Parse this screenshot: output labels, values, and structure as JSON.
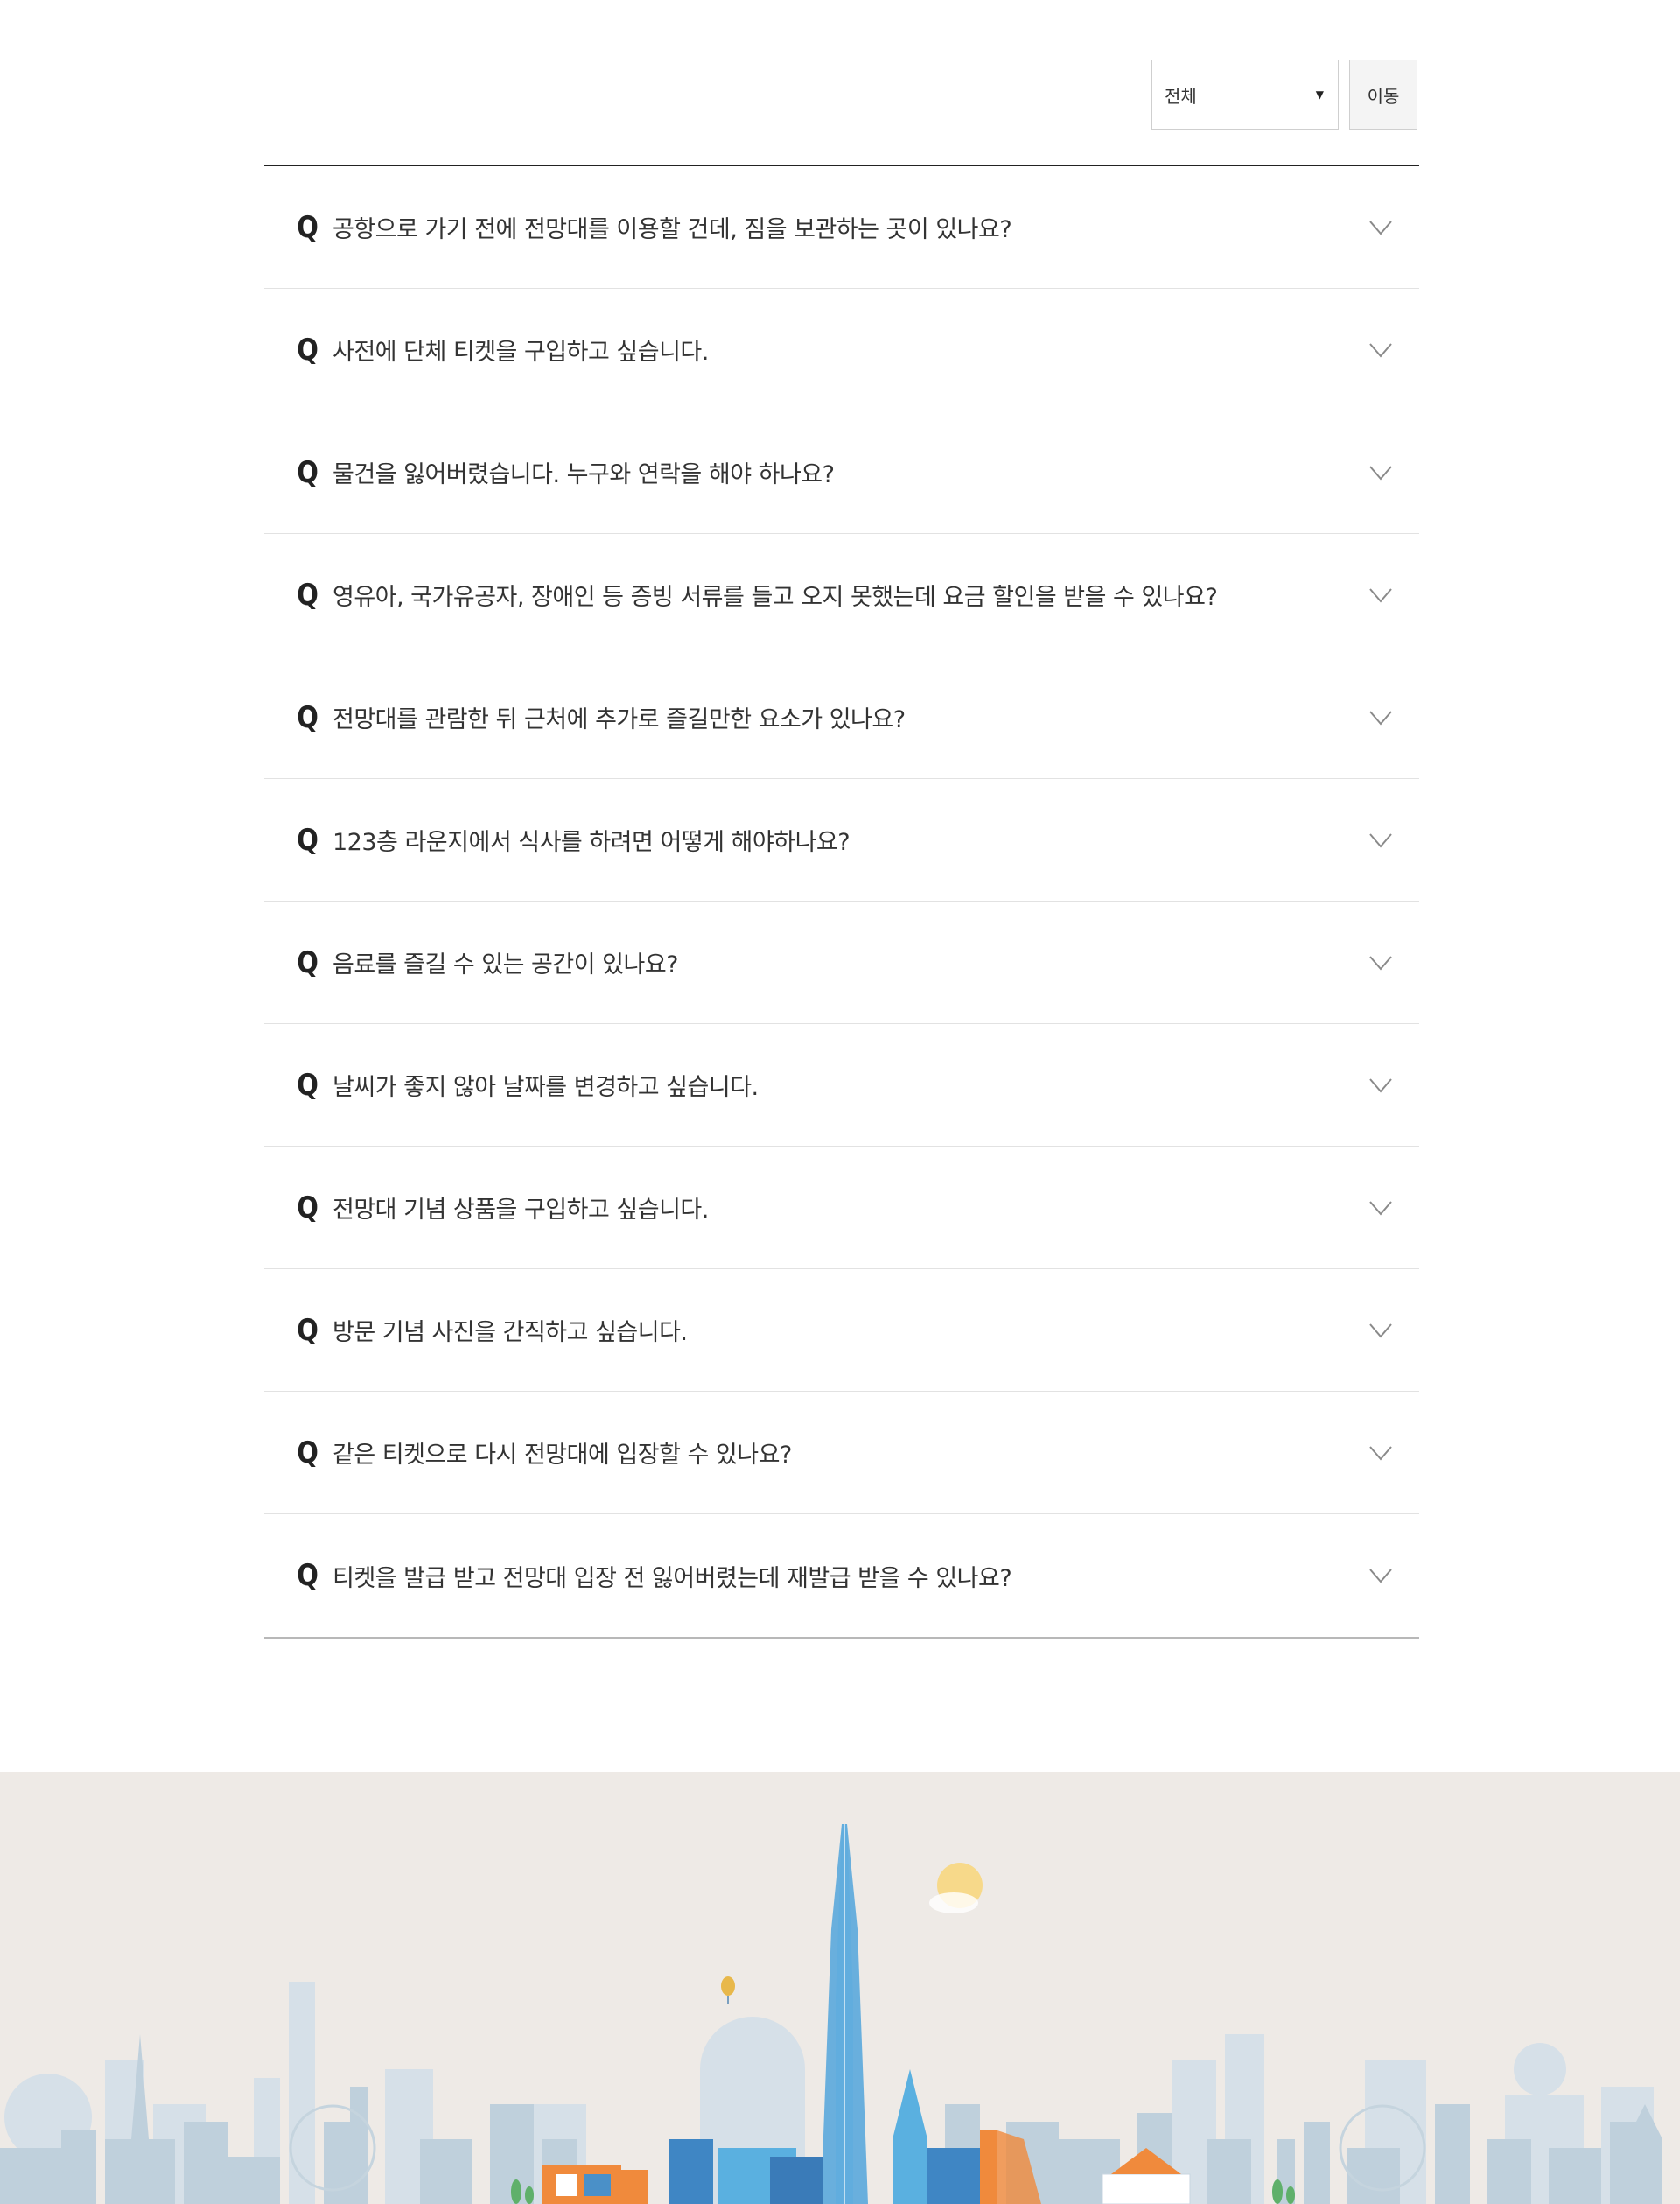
{
  "filter": {
    "selected_option": "전체",
    "go_label": "이동"
  },
  "faq": {
    "q_label": "Q",
    "items": [
      {
        "question": "공항으로 가기 전에 전망대를 이용할 건데, 짐을 보관하는 곳이 있나요?"
      },
      {
        "question": "사전에 단체 티켓을 구입하고 싶습니다."
      },
      {
        "question": "물건을 잃어버렸습니다. 누구와 연락을 해야 하나요?"
      },
      {
        "question": "영유아, 국가유공자, 장애인 등 증빙 서류를 들고 오지 못했는데 요금 할인을 받을 수 있나요?"
      },
      {
        "question": "전망대를 관람한 뒤 근처에 추가로 즐길만한 요소가 있나요?"
      },
      {
        "question": "123층 라운지에서 식사를 하려면 어떻게 해야하나요?"
      },
      {
        "question": "음료를 즐길 수 있는 공간이 있나요?"
      },
      {
        "question": "날씨가 좋지 않아 날짜를 변경하고 싶습니다."
      },
      {
        "question": "전망대 기념 상품을 구입하고 싶습니다."
      },
      {
        "question": "방문 기념 사진을 간직하고 싶습니다."
      },
      {
        "question": "같은 티켓으로 다시 전망대에 입장할 수 있나요?"
      },
      {
        "question": "티켓을 발급 받고 전망대 입장 전 잃어버렸는데 재발급 받을 수 있나요?"
      }
    ]
  },
  "colors": {
    "footer_bg": "#eeeae6",
    "skyline_far": "#d3dee6",
    "skyline_near": "#b9ccd8",
    "tower": "#5aa8dc",
    "accent_orange": "#f08a3c",
    "sun": "#f7d98a"
  }
}
